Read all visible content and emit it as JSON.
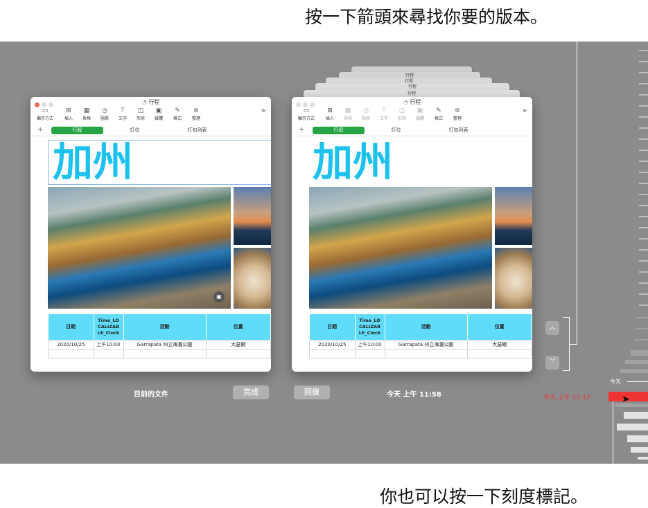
{
  "callouts": {
    "top": "按一下箭頭來尋找你要的版本。",
    "bottom": "你也可以按一下刻度標記。"
  },
  "doc_title": "行程",
  "stack_titles": [
    "行程",
    "行程",
    "行程",
    "行程"
  ],
  "toolbar": {
    "view": "顯示方式",
    "insert": "插入",
    "table": "表格",
    "chart": "圖表",
    "text": "文字",
    "shape": "形狀",
    "media": "媒體",
    "format": "格式",
    "organize": "整理",
    "more": "»"
  },
  "tabs": {
    "add": "+",
    "itinerary": "行程",
    "booking": "訂位",
    "packing": "打包列表"
  },
  "page_heading": "加州",
  "table": {
    "headers": [
      "日期",
      "Time_LO CALIZAB LE_Clock",
      "活動",
      "位置"
    ],
    "row": [
      "2020/10/25",
      "上午10:00",
      "Garrapata 州立海灘公園",
      "大瑟爾"
    ]
  },
  "current_label": "目前的文件",
  "done_button": "完成",
  "restore_button": "回復",
  "version_time": "今天 上午 11:58",
  "timeline": {
    "today": "今天",
    "selected": "今天 上午 11:17"
  },
  "colors": {
    "accent_tab": "#27a444",
    "title": "#1cc1ee",
    "table_header": "#5fdcf9",
    "timeline_selected": "#ee3333"
  }
}
